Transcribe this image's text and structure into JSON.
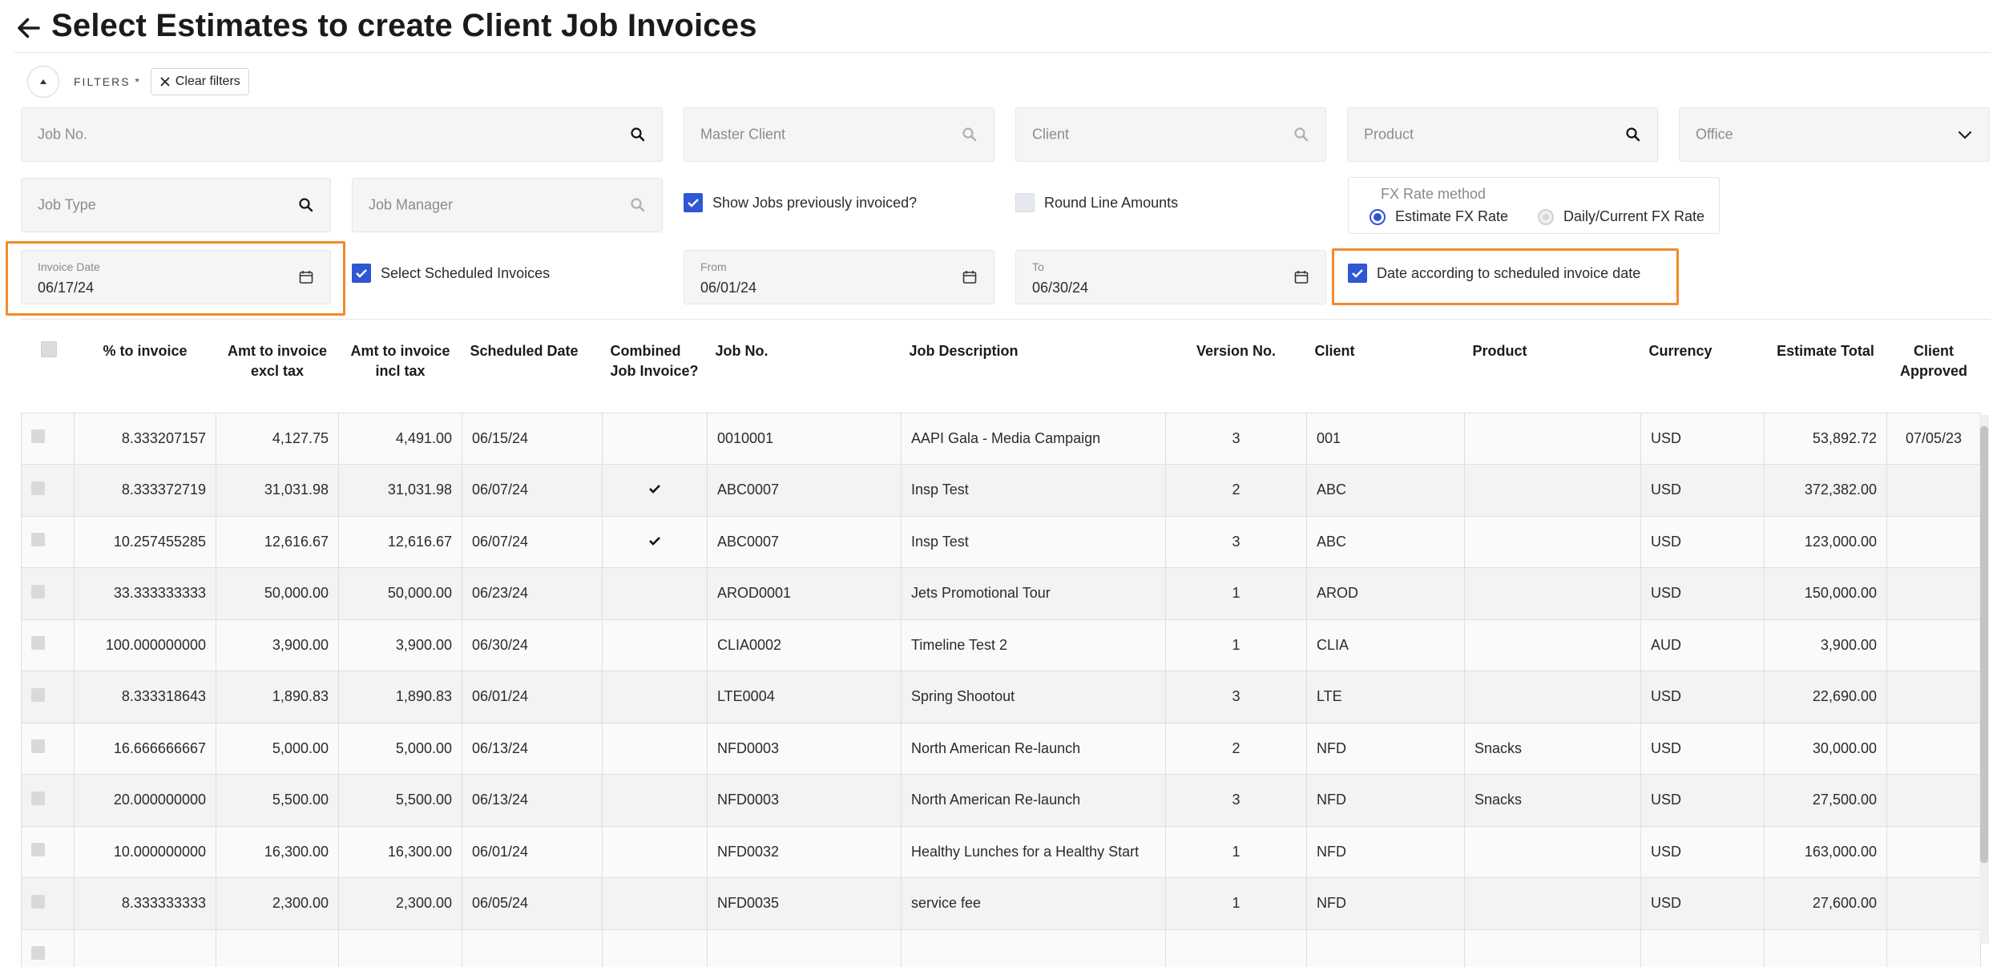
{
  "page": {
    "title": "Select Estimates to create Client Job Invoices"
  },
  "filters": {
    "label": "FILTERS *",
    "clear_label": "Clear filters",
    "job_no_placeholder": "Job No.",
    "master_client_placeholder": "Master Client",
    "client_placeholder": "Client",
    "product_placeholder": "Product",
    "office_placeholder": "Office",
    "job_type_placeholder": "Job Type",
    "job_manager_placeholder": "Job Manager",
    "show_prev_invoiced_label": "Show Jobs previously invoiced?",
    "round_line_amounts_label": "Round Line Amounts",
    "fx_rate_method_label": "FX Rate method",
    "fx_estimate_label": "Estimate FX Rate",
    "fx_daily_label": "Daily/Current FX Rate",
    "invoice_date_label": "Invoice Date",
    "invoice_date_value": "06/17/24",
    "select_scheduled_label": "Select Scheduled Invoices",
    "from_label": "From",
    "from_value": "06/01/24",
    "to_label": "To",
    "to_value": "06/30/24",
    "date_according_label": "Date according to scheduled invoice date"
  },
  "table": {
    "headers": {
      "pct": "% to invoice",
      "amt_excl": "Amt to invoice excl tax",
      "amt_incl": "Amt to invoice incl tax",
      "scheduled": "Scheduled Date",
      "combined": "Combined Job Invoice?",
      "job_no": "Job No.",
      "job_desc": "Job Description",
      "version": "Version No.",
      "client": "Client",
      "product": "Product",
      "currency": "Currency",
      "estimate_total": "Estimate Total",
      "client_approved": "Client Approved"
    },
    "rows": [
      {
        "pct": "8.333207157",
        "amt_excl": "4,127.75",
        "amt_incl": "4,491.00",
        "scheduled": "06/15/24",
        "combined": false,
        "job_no": "0010001",
        "job_desc": "AAPI Gala - Media Campaign",
        "version": "3",
        "client": "001",
        "product": "",
        "currency": "USD",
        "estimate_total": "53,892.72",
        "client_approved": "07/05/23"
      },
      {
        "pct": "8.333372719",
        "amt_excl": "31,031.98",
        "amt_incl": "31,031.98",
        "scheduled": "06/07/24",
        "combined": true,
        "job_no": "ABC0007",
        "job_desc": "Insp Test",
        "version": "2",
        "client": "ABC",
        "product": "",
        "currency": "USD",
        "estimate_total": "372,382.00",
        "client_approved": ""
      },
      {
        "pct": "10.257455285",
        "amt_excl": "12,616.67",
        "amt_incl": "12,616.67",
        "scheduled": "06/07/24",
        "combined": true,
        "job_no": "ABC0007",
        "job_desc": "Insp Test",
        "version": "3",
        "client": "ABC",
        "product": "",
        "currency": "USD",
        "estimate_total": "123,000.00",
        "client_approved": ""
      },
      {
        "pct": "33.333333333",
        "amt_excl": "50,000.00",
        "amt_incl": "50,000.00",
        "scheduled": "06/23/24",
        "combined": false,
        "job_no": "AROD0001",
        "job_desc": "Jets Promotional Tour",
        "version": "1",
        "client": "AROD",
        "product": "",
        "currency": "USD",
        "estimate_total": "150,000.00",
        "client_approved": ""
      },
      {
        "pct": "100.000000000",
        "amt_excl": "3,900.00",
        "amt_incl": "3,900.00",
        "scheduled": "06/30/24",
        "combined": false,
        "job_no": "CLIA0002",
        "job_desc": "Timeline Test 2",
        "version": "1",
        "client": "CLIA",
        "product": "",
        "currency": "AUD",
        "estimate_total": "3,900.00",
        "client_approved": ""
      },
      {
        "pct": "8.333318643",
        "amt_excl": "1,890.83",
        "amt_incl": "1,890.83",
        "scheduled": "06/01/24",
        "combined": false,
        "job_no": "LTE0004",
        "job_desc": "Spring Shootout",
        "version": "3",
        "client": "LTE",
        "product": "",
        "currency": "USD",
        "estimate_total": "22,690.00",
        "client_approved": ""
      },
      {
        "pct": "16.666666667",
        "amt_excl": "5,000.00",
        "amt_incl": "5,000.00",
        "scheduled": "06/13/24",
        "combined": false,
        "job_no": "NFD0003",
        "job_desc": "North American Re-launch",
        "version": "2",
        "client": "NFD",
        "product": "Snacks",
        "currency": "USD",
        "estimate_total": "30,000.00",
        "client_approved": ""
      },
      {
        "pct": "20.000000000",
        "amt_excl": "5,500.00",
        "amt_incl": "5,500.00",
        "scheduled": "06/13/24",
        "combined": false,
        "job_no": "NFD0003",
        "job_desc": "North American Re-launch",
        "version": "3",
        "client": "NFD",
        "product": "Snacks",
        "currency": "USD",
        "estimate_total": "27,500.00",
        "client_approved": ""
      },
      {
        "pct": "10.000000000",
        "amt_excl": "16,300.00",
        "amt_incl": "16,300.00",
        "scheduled": "06/01/24",
        "combined": false,
        "job_no": "NFD0032",
        "job_desc": "Healthy Lunches for a Healthy Start",
        "version": "1",
        "client": "NFD",
        "product": "",
        "currency": "USD",
        "estimate_total": "163,000.00",
        "client_approved": ""
      },
      {
        "pct": "8.333333333",
        "amt_excl": "2,300.00",
        "amt_incl": "2,300.00",
        "scheduled": "06/05/24",
        "combined": false,
        "job_no": "NFD0035",
        "job_desc": "service fee",
        "version": "1",
        "client": "NFD",
        "product": "",
        "currency": "USD",
        "estimate_total": "27,600.00",
        "client_approved": ""
      },
      {
        "pct": "",
        "amt_excl": "",
        "amt_incl": "",
        "scheduled": "",
        "combined": false,
        "job_no": "",
        "job_desc": "",
        "version": "",
        "client": "",
        "product": "",
        "currency": "",
        "estimate_total": "",
        "client_approved": ""
      }
    ]
  },
  "colors": {
    "accent": "#2f56d3",
    "highlight": "#f28a2e"
  }
}
